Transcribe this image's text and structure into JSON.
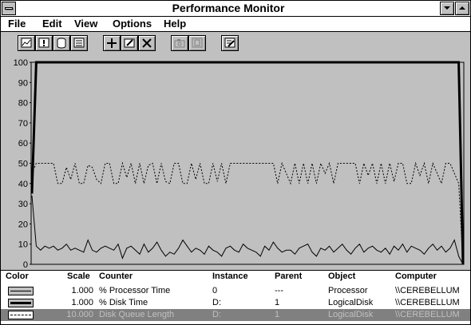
{
  "window": {
    "title": "Performance Monitor"
  },
  "menu": [
    "File",
    "Edit",
    "View",
    "Options",
    "Help"
  ],
  "toolbar": [
    {
      "icon": "chart-view-icon",
      "enabled": true
    },
    {
      "icon": "alert-view-icon",
      "enabled": true
    },
    {
      "icon": "log-view-icon",
      "enabled": true
    },
    {
      "icon": "report-view-icon",
      "enabled": true
    },
    {
      "icon": "add-counter-icon",
      "glyph": "+",
      "enabled": true
    },
    {
      "icon": "edit-counter-icon",
      "enabled": true
    },
    {
      "icon": "delete-counter-icon",
      "glyph": "✕",
      "enabled": true
    },
    {
      "icon": "update-now-icon",
      "enabled": false
    },
    {
      "icon": "bookmark-icon",
      "enabled": false
    },
    {
      "icon": "options-icon",
      "enabled": true
    }
  ],
  "chart_data": {
    "type": "line",
    "ylim": [
      0,
      100
    ],
    "yticks": [
      "100",
      "90",
      "80",
      "70",
      "60",
      "50",
      "40",
      "30",
      "20",
      "10",
      "0"
    ],
    "grid": false,
    "series": [
      {
        "name": "% Processor Time",
        "style": "thin",
        "values": [
          34,
          9,
          7,
          9,
          8,
          9,
          7,
          8,
          10,
          7,
          8,
          7,
          6,
          12,
          7,
          6,
          8,
          9,
          8,
          7,
          10,
          3,
          8,
          9,
          7,
          5,
          10,
          6,
          8,
          11,
          7,
          4,
          6,
          5,
          8,
          12,
          9,
          6,
          8,
          7,
          5,
          9,
          7,
          6,
          4,
          8,
          9,
          7,
          6,
          10,
          8,
          7,
          6,
          4,
          9,
          7,
          11,
          8,
          6,
          7,
          7,
          5,
          8,
          9,
          10,
          6,
          4,
          8,
          7,
          9,
          6,
          8,
          10,
          7,
          5,
          8,
          10,
          6,
          8,
          9,
          7,
          6,
          8,
          5,
          9,
          7,
          10,
          6,
          9,
          8,
          7,
          5,
          8,
          10,
          7,
          9,
          6,
          8,
          12,
          4,
          0
        ]
      },
      {
        "name": "% Disk Time",
        "style": "thick",
        "values": [
          35,
          100,
          100,
          100,
          100,
          100,
          100,
          100,
          100,
          100,
          100,
          100,
          100,
          100,
          100,
          100,
          100,
          100,
          100,
          100,
          100,
          100,
          100,
          100,
          100,
          100,
          100,
          100,
          100,
          100,
          100,
          100,
          100,
          100,
          100,
          100,
          100,
          100,
          100,
          100,
          100,
          100,
          100,
          100,
          100,
          100,
          100,
          100,
          100,
          100,
          100,
          100,
          100,
          100,
          100,
          100,
          100,
          100,
          100,
          100,
          100,
          100,
          100,
          100,
          100,
          100,
          100,
          100,
          100,
          100,
          100,
          100,
          100,
          100,
          100,
          100,
          100,
          100,
          100,
          100,
          100,
          100,
          100,
          100,
          100,
          100,
          100,
          100,
          100,
          100,
          100,
          100,
          100,
          100,
          100,
          100,
          100,
          100,
          100,
          100,
          0
        ]
      },
      {
        "name": "Disk Queue Length",
        "style": "dashed",
        "values": [
          45,
          50,
          50,
          50,
          50,
          50,
          40,
          40,
          48,
          42,
          50,
          40,
          40,
          49,
          48,
          42,
          40,
          50,
          50,
          40,
          40,
          50,
          43,
          50,
          40,
          50,
          40,
          49,
          50,
          40,
          50,
          41,
          40,
          50,
          50,
          40,
          40,
          50,
          42,
          50,
          40,
          40,
          50,
          41,
          50,
          40,
          50,
          50,
          50,
          50,
          50,
          50,
          50,
          50,
          50,
          50,
          50,
          40,
          50,
          45,
          40,
          50,
          40,
          50,
          40,
          50,
          40,
          50,
          45,
          50,
          40,
          50,
          50,
          50,
          50,
          50,
          40,
          50,
          44,
          50,
          40,
          50,
          40,
          50,
          41,
          50,
          50,
          40,
          40,
          50,
          44,
          50,
          40,
          50,
          45,
          40,
          50,
          50,
          45,
          40,
          0
        ]
      }
    ]
  },
  "legend": {
    "headers": {
      "color": "Color",
      "scale": "Scale",
      "counter": "Counter",
      "instance": "Instance",
      "parent": "Parent",
      "object": "Object",
      "computer": "Computer"
    },
    "rows": [
      {
        "swatch": "thin",
        "scale": "1.000",
        "counter": "% Processor Time",
        "instance": "0",
        "parent": "---",
        "object": "Processor",
        "computer": "\\\\CEREBELLUM"
      },
      {
        "swatch": "thick",
        "scale": "1.000",
        "counter": "% Disk Time",
        "instance": "D:",
        "parent": "1",
        "object": "LogicalDisk",
        "computer": "\\\\CEREBELLUM"
      },
      {
        "swatch": "dashed",
        "scale": "10.000",
        "counter": "Disk Queue Length",
        "instance": "D:",
        "parent": "1",
        "object": "LogicalDisk",
        "computer": "\\\\CEREBELLUM",
        "selected": true
      }
    ]
  }
}
